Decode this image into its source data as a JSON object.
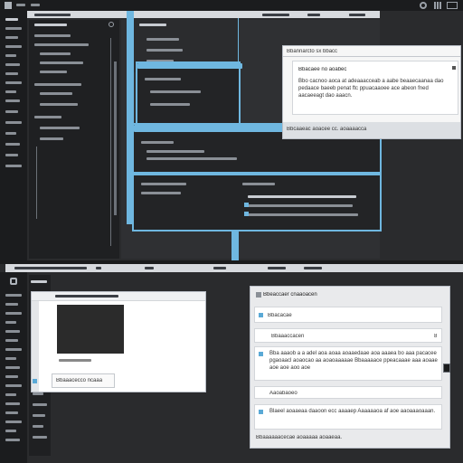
{
  "top_window": {
    "title": "",
    "toolbar_icons": [
      "gear-icon",
      "grid-icon",
      "window-icon"
    ],
    "sidebar_header": "",
    "panel_a": {
      "label": "",
      "rows": [
        "",
        "",
        ""
      ]
    },
    "panel_b": {
      "label": "",
      "rows": [
        "",
        ""
      ]
    },
    "panel_c": {
      "rows": [
        "",
        "",
        ""
      ]
    }
  },
  "dialog": {
    "title": "Bbannarcto sx bbacc",
    "heading": "Bbacaee no aoabec",
    "body": "Bbo cacnoo aoca at adeaaacceab a aabe beaaecaanaa dao pedaace baeeb penat ftc ppuacaaoee ace abeon fned aacaeeagt dao aaacn.",
    "footer": "Bbcaaeac aoacee cc. aoaaaacca"
  },
  "bottom_window": {
    "title": "",
    "left_dialog": {
      "caption": "Bbaaacecco ncaaa"
    },
    "right_dialog": {
      "heading": "Bbeaccaer cnaaoacen",
      "item1": "Bbacacae",
      "item2": "Bbaaaccacen",
      "item2_badge": "8",
      "para1": "Bba aaaob a a adel aoa aoaa aoaaedaae aoa aaaea bo aaa pacacee pgaoaacl aoaocao aa aoaoaaaaae Bbaaaaace ppeacaaae aaa aoaae aoe aoe aoo aoe",
      "item3": "Aaoabaoeo",
      "para2": "Blaeel aoaaeaa daaoon ecc aaaaep Aaaaaaoa af aoe aaoaaaoaaan.",
      "footer": "Bbaaaaaacecae aoaaaaa aoaaeaa."
    }
  },
  "colors": {
    "background": "#2c2d2f",
    "accent": "#6fb7e0",
    "dark_pane": "#1f2022",
    "light_window": "#f3f4f6"
  }
}
